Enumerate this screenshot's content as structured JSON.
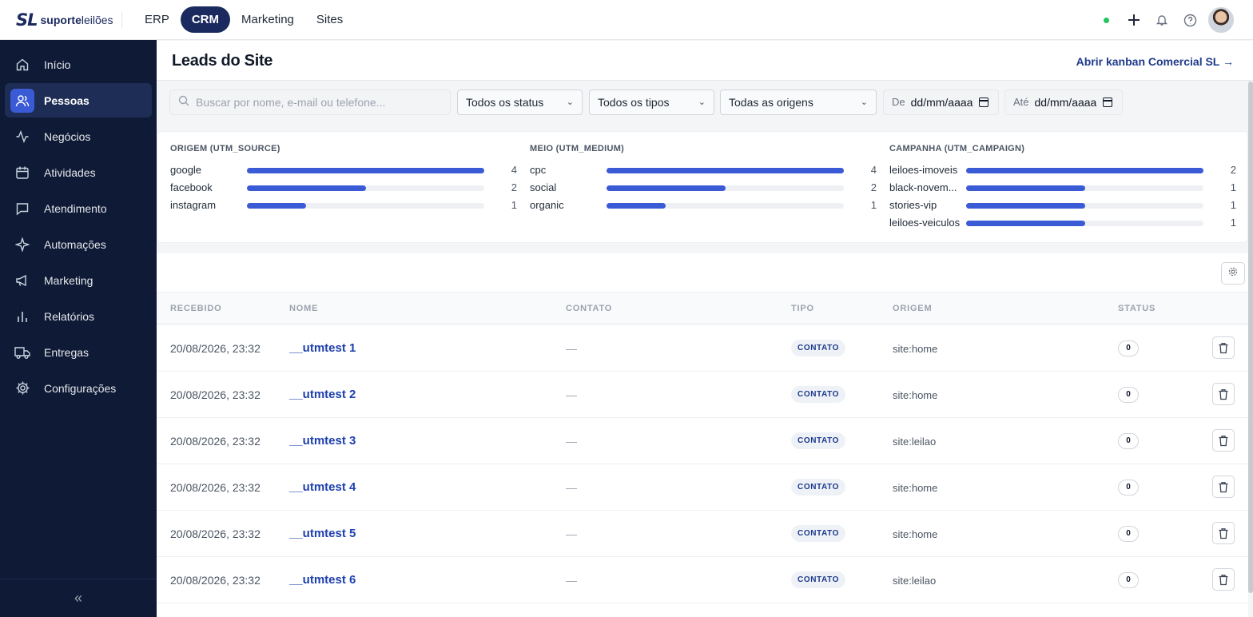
{
  "brand": {
    "mark": "SL",
    "name_bold": "suporte",
    "name_light": "leilões"
  },
  "topnav": [
    {
      "label": "ERP",
      "active": false
    },
    {
      "label": "CRM",
      "active": true
    },
    {
      "label": "Marketing",
      "active": false
    },
    {
      "label": "Sites",
      "active": false
    }
  ],
  "top_icons": [
    "online-status-dot",
    "plus-icon",
    "bell-icon",
    "help-icon",
    "user-avatar"
  ],
  "sidebar": {
    "items": [
      {
        "label": "Início",
        "icon": "home-icon",
        "active": false
      },
      {
        "label": "Pessoas",
        "icon": "users-icon",
        "active": true
      },
      {
        "label": "Negócios",
        "icon": "activity-icon",
        "active": false
      },
      {
        "label": "Atividades",
        "icon": "calendar-icon",
        "active": false
      },
      {
        "label": "Atendimento",
        "icon": "chat-icon",
        "active": false
      },
      {
        "label": "Automações",
        "icon": "sparkle-icon",
        "active": false
      },
      {
        "label": "Marketing",
        "icon": "megaphone-icon",
        "active": false
      },
      {
        "label": "Relatórios",
        "icon": "bar-chart-icon",
        "active": false
      },
      {
        "label": "Entregas",
        "icon": "truck-icon",
        "active": false
      },
      {
        "label": "Configurações",
        "icon": "gear-icon",
        "active": false
      }
    ],
    "collapse_label": "«"
  },
  "header": {
    "title": "Leads do Site",
    "kanban_link": "Abrir kanban Comercial SL →"
  },
  "filters": {
    "search_placeholder": "Buscar por nome, e-mail ou telefone...",
    "status": "Todos os status",
    "types": "Todos os tipos",
    "origins": "Todas as origens",
    "from_label": "De",
    "from_value": "dd/mm/aaaa",
    "to_label": "Até",
    "to_value": "dd/mm/aaaa"
  },
  "utm": {
    "source": {
      "title": "ORIGEM (UTM_SOURCE)",
      "rows": [
        {
          "label": "google",
          "count": 4,
          "fraction": 1.0
        },
        {
          "label": "facebook",
          "count": 2,
          "fraction": 0.5
        },
        {
          "label": "instagram",
          "count": 1,
          "fraction": 0.25
        }
      ]
    },
    "medium": {
      "title": "MEIO (UTM_MEDIUM)",
      "rows": [
        {
          "label": "cpc",
          "count": 4,
          "fraction": 1.0
        },
        {
          "label": "social",
          "count": 2,
          "fraction": 0.5
        },
        {
          "label": "organic",
          "count": 1,
          "fraction": 0.25
        }
      ]
    },
    "campaign": {
      "title": "CAMPANHA (UTM_CAMPAIGN)",
      "rows": [
        {
          "label": "leiloes-imoveis",
          "count": 2,
          "fraction": 1.0
        },
        {
          "label": "black-novem...",
          "count": 1,
          "fraction": 0.5
        },
        {
          "label": "stories-vip",
          "count": 1,
          "fraction": 0.5
        },
        {
          "label": "leiloes-veiculos",
          "count": 1,
          "fraction": 0.5
        }
      ]
    }
  },
  "table": {
    "columns": [
      "RECEBIDO",
      "NOME",
      "CONTATO",
      "TIPO",
      "ORIGEM",
      "STATUS"
    ],
    "rows": [
      {
        "received": "20/08/2026, 23:32",
        "name": "__utmtest 1",
        "contact": "—",
        "type": "CONTATO",
        "origin": "site:home",
        "status": "0"
      },
      {
        "received": "20/08/2026, 23:32",
        "name": "__utmtest 2",
        "contact": "—",
        "type": "CONTATO",
        "origin": "site:home",
        "status": "0"
      },
      {
        "received": "20/08/2026, 23:32",
        "name": "__utmtest 3",
        "contact": "—",
        "type": "CONTATO",
        "origin": "site:leilao",
        "status": "0"
      },
      {
        "received": "20/08/2026, 23:32",
        "name": "__utmtest 4",
        "contact": "—",
        "type": "CONTATO",
        "origin": "site:home",
        "status": "0"
      },
      {
        "received": "20/08/2026, 23:32",
        "name": "__utmtest 5",
        "contact": "—",
        "type": "CONTATO",
        "origin": "site:home",
        "status": "0"
      },
      {
        "received": "20/08/2026, 23:32",
        "name": "__utmtest 6",
        "contact": "—",
        "type": "CONTATO",
        "origin": "site:leilao",
        "status": "0"
      }
    ]
  },
  "colors": {
    "brand_navy": "#1a2a5e",
    "sidebar_bg": "#0e1a36",
    "accent_blue": "#3b5bd6",
    "online_green": "#22c55e"
  }
}
